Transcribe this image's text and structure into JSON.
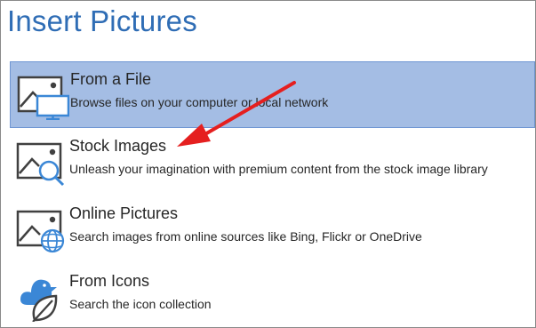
{
  "dialog": {
    "title": "Insert Pictures"
  },
  "options": [
    {
      "title": "From a File",
      "description": "Browse files on your computer or local network",
      "icon": "picture-monitor-icon",
      "selected": true
    },
    {
      "title": "Stock Images",
      "description": "Unleash your imagination with premium content from the stock image library",
      "icon": "picture-search-icon",
      "selected": false
    },
    {
      "title": "Online Pictures",
      "description": "Search images from online sources like Bing, Flickr or OneDrive",
      "icon": "picture-globe-icon",
      "selected": false
    },
    {
      "title": "From Icons",
      "description": "Search the icon collection",
      "icon": "icons-bird-leaf-icon",
      "selected": false
    }
  ],
  "colors": {
    "title": "#2f6db5",
    "selected_bg": "#a4bde4",
    "accent_blue": "#3b87d6",
    "annotation_arrow": "#e51f1f"
  }
}
